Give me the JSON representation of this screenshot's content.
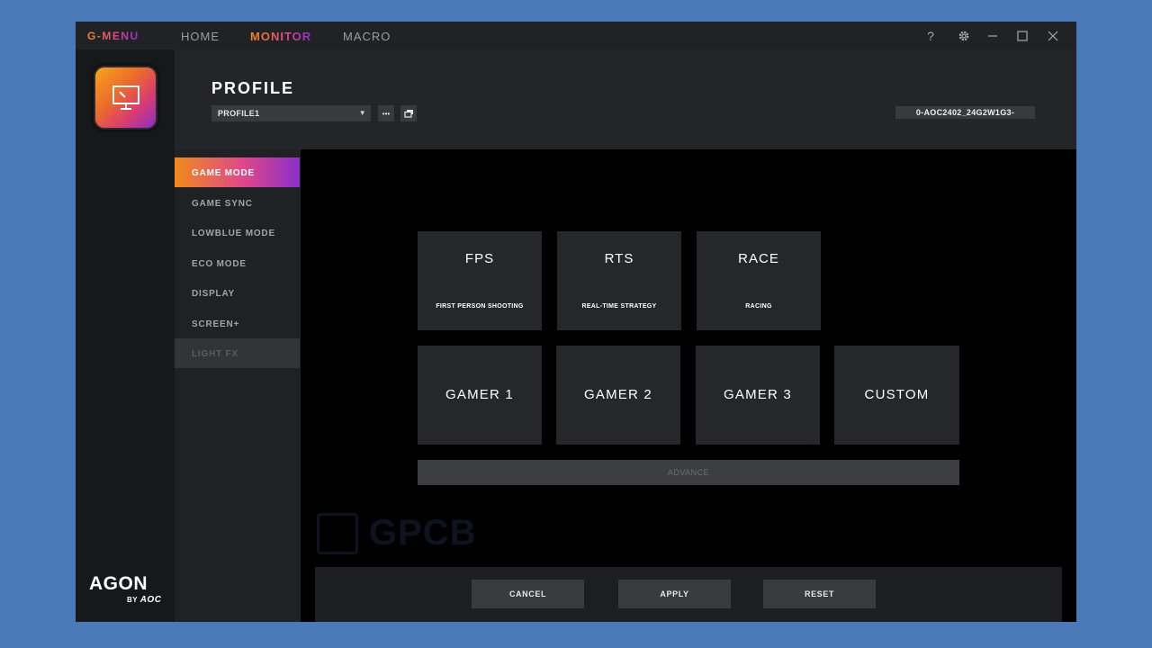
{
  "titlebar": {
    "brand": "G-MENU",
    "nav": [
      "HOME",
      "MONITOR",
      "MACRO"
    ],
    "active_nav": "MONITOR",
    "help": "?"
  },
  "header": {
    "title": "PROFILE",
    "profile_select": "PROFILE1",
    "more_button": "•••",
    "device_id": "0-AOC2402_24G2W1G3-"
  },
  "sidebar": {
    "items": [
      {
        "label": "GAME MODE",
        "state": "active"
      },
      {
        "label": "GAME SYNC",
        "state": "normal"
      },
      {
        "label": "LOWBLUE MODE",
        "state": "normal"
      },
      {
        "label": "ECO MODE",
        "state": "normal"
      },
      {
        "label": "DISPLAY",
        "state": "normal"
      },
      {
        "label": "SCREEN+",
        "state": "normal"
      },
      {
        "label": "LIGHT FX",
        "state": "disabled"
      }
    ]
  },
  "modes": {
    "row1": [
      {
        "name": "FPS",
        "sub": "FIRST PERSON SHOOTING"
      },
      {
        "name": "RTS",
        "sub": "REAL-TIME STRATEGY"
      },
      {
        "name": "RACE",
        "sub": "RACING"
      }
    ],
    "row2": [
      "GAMER 1",
      "GAMER 2",
      "GAMER 3",
      "CUSTOM"
    ],
    "advance": "ADVANCE"
  },
  "footer": {
    "cancel": "CANCEL",
    "apply": "APPLY",
    "reset": "RESET"
  },
  "branding": {
    "agon": "AGON",
    "by": "BY",
    "aoc": "AOC",
    "watermark": "GPCB"
  },
  "colors": {
    "accent_start": "#f08a1c",
    "accent_mid": "#e0478a",
    "accent_end": "#8a2fc9",
    "background": "#4a79b8"
  }
}
